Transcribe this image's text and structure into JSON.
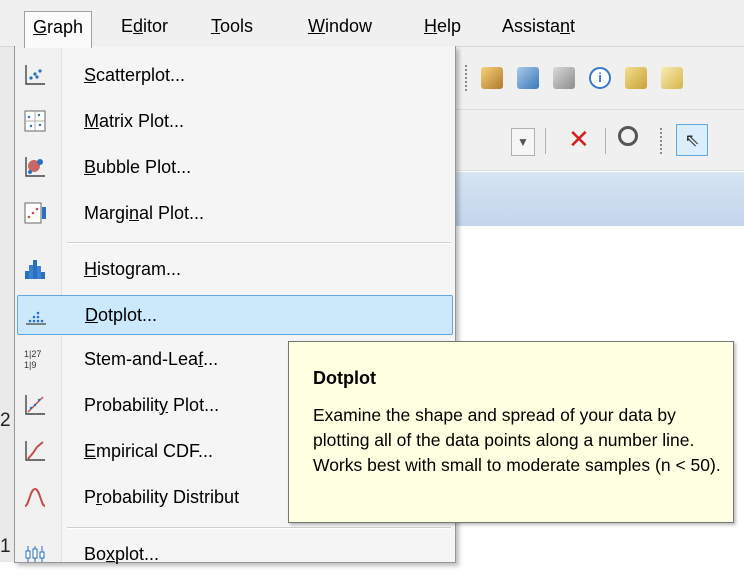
{
  "menubar": {
    "items": [
      {
        "pre": "",
        "key": "G",
        "post": "raph",
        "active": true
      },
      {
        "pre": "E",
        "key": "d",
        "post": "itor",
        "active": false
      },
      {
        "pre": "",
        "key": "T",
        "post": "ools",
        "active": false
      },
      {
        "pre": "",
        "key": "W",
        "post": "indow",
        "active": false
      },
      {
        "pre": "",
        "key": "H",
        "post": "elp",
        "active": false
      },
      {
        "pre": "Assista",
        "key": "n",
        "post": "t",
        "active": false
      }
    ]
  },
  "graph_menu": {
    "items": [
      {
        "pre": "",
        "key": "S",
        "post": "catterplot...",
        "icon": "scatterplot-icon"
      },
      {
        "pre": "",
        "key": "M",
        "post": "atrix Plot...",
        "icon": "matrix-plot-icon"
      },
      {
        "pre": "",
        "key": "B",
        "post": "ubble Plot...",
        "icon": "bubble-plot-icon"
      },
      {
        "pre": "Margi",
        "key": "n",
        "post": "al Plot...",
        "icon": "marginal-plot-icon"
      },
      {
        "pre": "",
        "key": "H",
        "post": "istogram...",
        "icon": "histogram-icon"
      },
      {
        "pre": "",
        "key": "D",
        "post": "otplot...",
        "icon": "dotplot-icon"
      },
      {
        "pre": "Stem-and-Lea",
        "key": "f",
        "post": "...",
        "icon": "stem-and-leaf-icon"
      },
      {
        "pre": "Probabilit",
        "key": "y",
        "post": " Plot...",
        "icon": "probability-plot-icon"
      },
      {
        "pre": "",
        "key": "E",
        "post": "mpirical CDF...",
        "icon": "empirical-cdf-icon"
      },
      {
        "pre": "P",
        "key": "r",
        "post": "obability Distribut",
        "icon": "probability-distribution-icon"
      },
      {
        "pre": "Bo",
        "key": "x",
        "post": "plot...",
        "icon": "boxplot-icon"
      }
    ],
    "highlighted": "Dotplot..."
  },
  "tooltip": {
    "title": "Dotplot",
    "body": "Examine the shape and spread of your data by plotting all of the data points along a number line. Works best with small to moderate samples (n < 50)."
  },
  "stray": {
    "a": "2",
    "b": "1"
  },
  "colors": {
    "highlight": "#cce8fb",
    "tooltip_bg": "#ffffe1",
    "menu_bg": "#f5f5f5"
  }
}
